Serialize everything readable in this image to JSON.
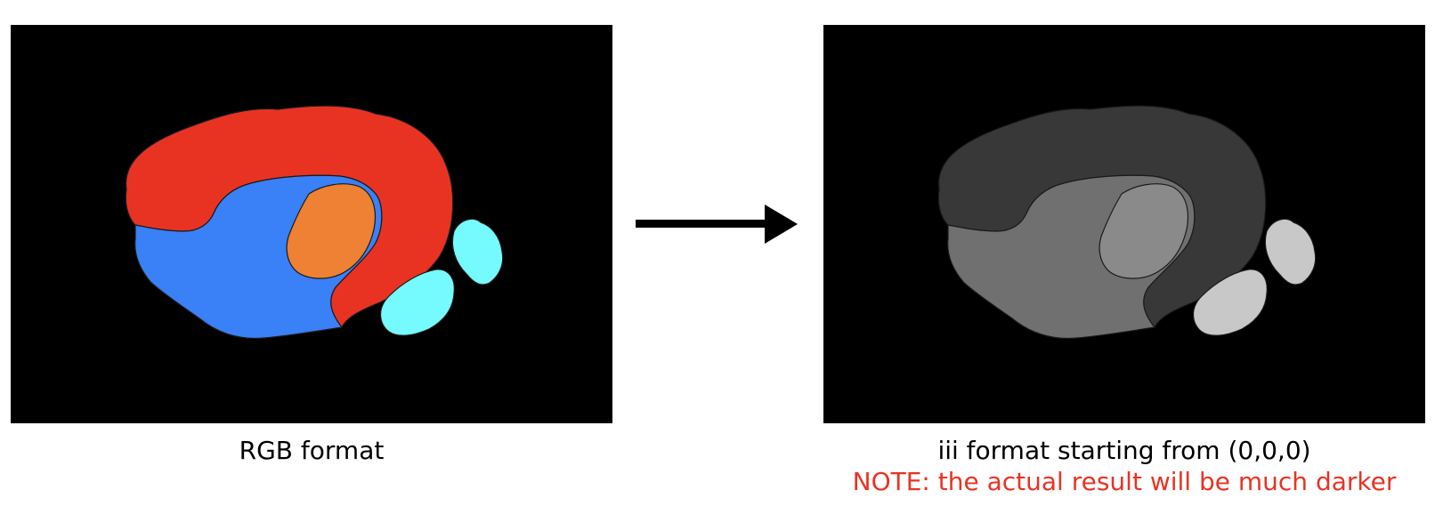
{
  "left_panel": {
    "caption": "RGB format",
    "colors": {
      "background": "#000000",
      "outer_region": "#e83323",
      "lower_region": "#3a80f6",
      "inner_region": "#ee8133",
      "small_regions": "#75fbfd"
    }
  },
  "right_panel": {
    "caption": "iii format starting from (0,0,0)",
    "note": "NOTE: the actual result will be much darker",
    "colors": {
      "background": "#000000",
      "outer_region": "#383838",
      "lower_region": "#707070",
      "inner_region": "#8a8a8a",
      "small_regions": "#c8c8c8"
    }
  },
  "arrow": {
    "color": "#000000"
  },
  "note_color": "#e83323"
}
